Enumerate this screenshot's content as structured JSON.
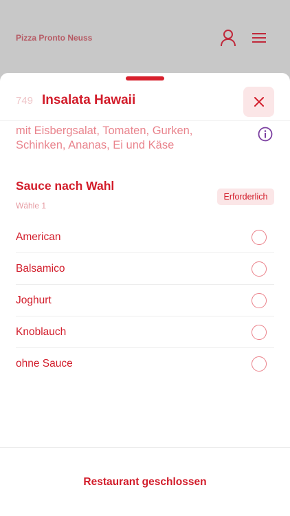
{
  "app": {
    "title": "Pizza Pronto Neuss"
  },
  "icons": {
    "user": "user-icon",
    "menu": "hamburger-menu-icon",
    "close": "close-icon",
    "info": "info-icon"
  },
  "colors": {
    "accent": "#d21c2a",
    "accent_light": "#fbe6e7",
    "info": "#7b3fa0"
  },
  "item": {
    "number": "749",
    "name": "Insalata Hawaii",
    "description": "mit Eisbergsalat, Tomaten, Gurken, Schinken, Ananas, Ei und Käse"
  },
  "section": {
    "title": "Sauce nach Wahl",
    "subtitle": "Wähle 1",
    "badge": "Erforderlich",
    "options": [
      {
        "label": "American"
      },
      {
        "label": "Balsamico"
      },
      {
        "label": "Joghurt"
      },
      {
        "label": "Knoblauch"
      },
      {
        "label": "ohne Sauce"
      }
    ]
  },
  "footer": {
    "status": "Restaurant geschlossen"
  }
}
